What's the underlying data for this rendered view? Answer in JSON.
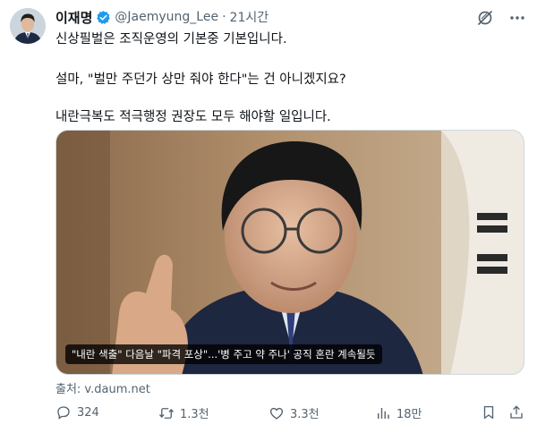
{
  "tweet": {
    "author": {
      "display_name": "이재명",
      "handle": "@Jaemyung_Lee",
      "verified": true
    },
    "separator": "·",
    "time": "21시간",
    "text_lines": [
      "신상필벌은 조직운영의 기본중 기본입니다.",
      "설마, \"벌만 주던가 상만 줘야 한다\"는 건 아니겠지요?",
      "내란극복도 적극행정 권장도 모두  해야할 일입니다."
    ],
    "media": {
      "caption": "\"내란 색출\" 다음날 \"파격 포상\"...'병 주고 약 주나' 공직 혼란 계속될듯"
    },
    "source": "출처: v.daum.net",
    "metrics": {
      "replies": "324",
      "retweets": "1.3천",
      "likes": "3.3천",
      "views": "18만"
    }
  },
  "icons": {
    "verified": "verified-badge-icon",
    "grok": "grok-icon",
    "more": "more-dots-icon",
    "reply": "reply-icon",
    "retweet": "retweet-icon",
    "like": "heart-icon",
    "views": "views-chart-icon",
    "bookmark": "bookmark-icon",
    "share": "share-icon"
  },
  "colors": {
    "text": "#0f1419",
    "secondary": "#536471",
    "verified": "#1d9bf0"
  }
}
